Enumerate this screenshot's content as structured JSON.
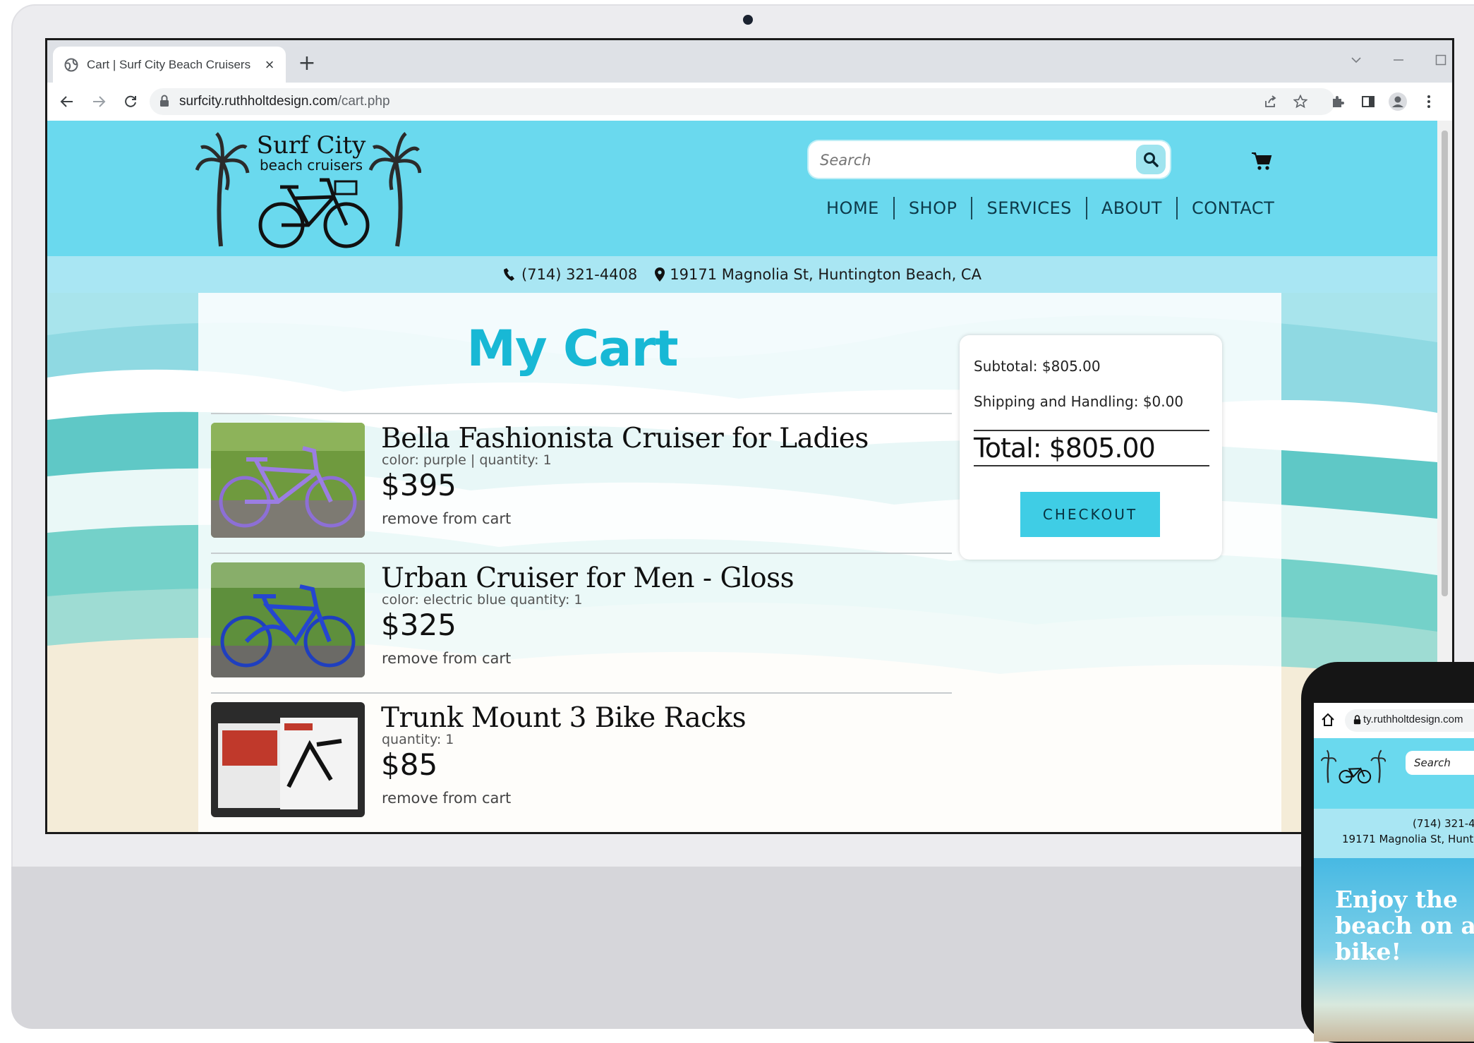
{
  "browser": {
    "tab_title": "Cart | Surf City Beach Cruisers",
    "url_domain": "surfcity.ruthholtdesign.com",
    "url_path": "/cart.php"
  },
  "site": {
    "search_placeholder": "Search",
    "nav": [
      "HOME",
      "SHOP",
      "SERVICES",
      "ABOUT",
      "CONTACT"
    ],
    "phone": "(714) 321-4408",
    "address": "19171 Magnolia St, Huntington Beach, CA"
  },
  "cart": {
    "title": "My Cart",
    "items": [
      {
        "name": "Bella Fashionista Cruiser for Ladies",
        "meta": "color: purple | quantity: 1",
        "price": "$395",
        "remove": "remove from cart"
      },
      {
        "name": "Urban Cruiser for Men - Gloss",
        "meta": "color: electric blue quantity: 1",
        "price": "$325",
        "remove": "remove from cart"
      },
      {
        "name": "Trunk Mount 3 Bike Racks",
        "meta": "quantity: 1",
        "price": "$85",
        "remove": "remove from cart"
      }
    ]
  },
  "summary": {
    "subtotal": "Subtotal: $805.00",
    "shipping": "Shipping and Handling: $0.00",
    "total": "Total: $805.00",
    "checkout": "CHECKOUT"
  },
  "phone_preview": {
    "url": "ty.ruthholtdesign.com",
    "search": "Search",
    "phone": "(714) 321-4",
    "address": "19171 Magnolia St, Hunti",
    "hero": "Enjoy the beach on a bike!"
  },
  "colors": {
    "header": "#6ad9ee",
    "infobar": "#a9e6f3",
    "accent": "#18b8d5",
    "checkout": "#3fcde5"
  }
}
